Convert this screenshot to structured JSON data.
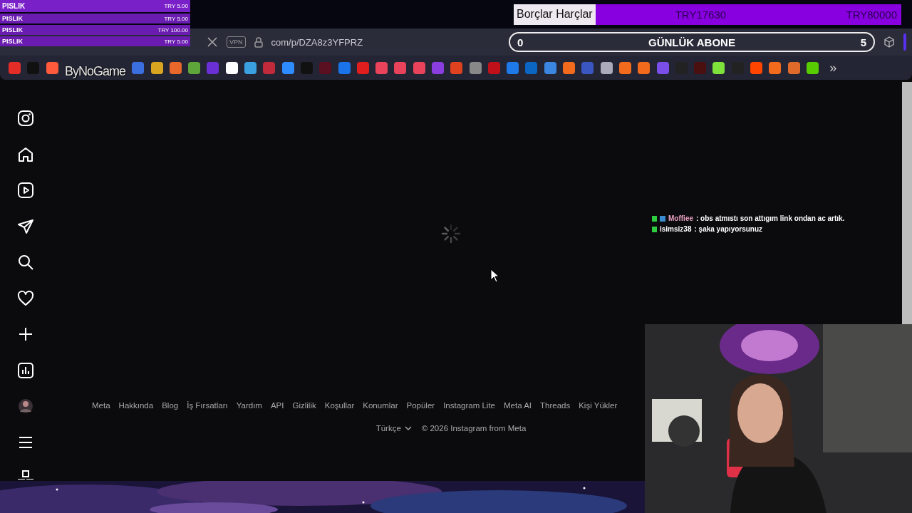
{
  "donations": [
    {
      "name": "PISLIK",
      "amount": "TRY 5.00"
    },
    {
      "name": "PISLIK",
      "amount": "TRY 5.00"
    },
    {
      "name": "PISLIK",
      "amount": "TRY 100.00"
    },
    {
      "name": "PISLIK",
      "amount": "TRY 5.00"
    }
  ],
  "goal": {
    "label": "Borçlar Harçlar",
    "current": "TRY17630",
    "target": "TRY80000"
  },
  "browser": {
    "vpn": "VPN",
    "url": "com/p/DZA8z3YFPRZ"
  },
  "subscriber_goal": {
    "count": "0",
    "label": "GÜNLÜK ABONE",
    "target": "5"
  },
  "overlay_logo": "ByNoGame",
  "bookmarks_more": "»",
  "chat": [
    {
      "user": "Moffiee",
      "text": ": obs atmıstı son attıgım link ondan ac artık.",
      "color": "#e9a1c4",
      "badge": true
    },
    {
      "user": "isimsiz38",
      "text": ": şaka yapıyorsunuz",
      "color": "#ffffff",
      "badge": false
    }
  ],
  "footer": {
    "links": [
      "Meta",
      "Hakkında",
      "Blog",
      "İş Fırsatları",
      "Yardım",
      "API",
      "Gizlilik",
      "Koşullar",
      "Konumlar",
      "Popüler",
      "Instagram Lite",
      "Meta AI",
      "Threads",
      "Kişi Yükler"
    ],
    "language": "Türkçe",
    "copyright": "© 2026 Instagram from Meta"
  }
}
